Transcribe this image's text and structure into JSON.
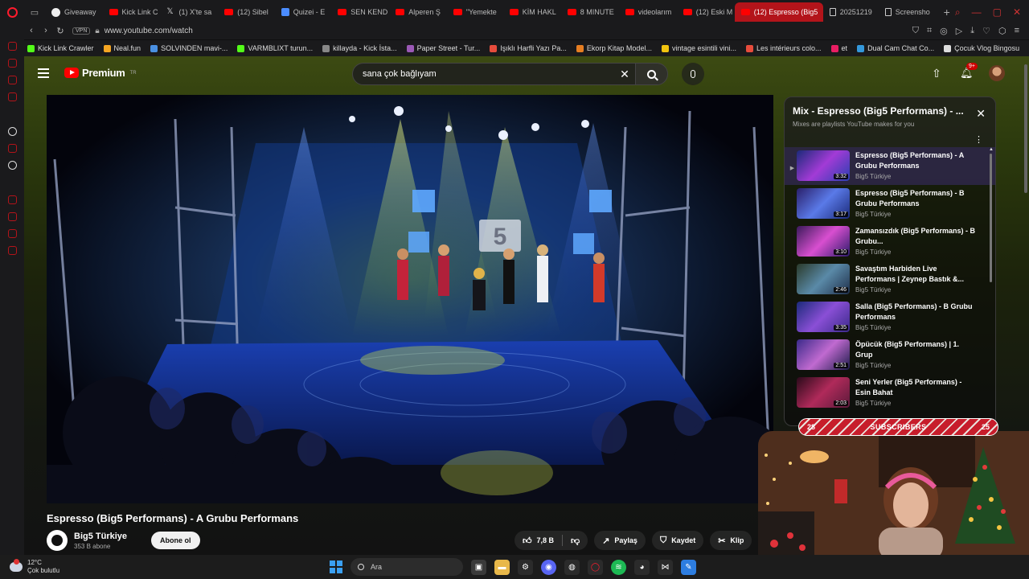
{
  "browser": {
    "tabs": [
      {
        "label": "Giveaway",
        "fav": "gh"
      },
      {
        "label": "Kick Link C",
        "fav": "yt"
      },
      {
        "label": "(1) X'te sa",
        "fav": "x"
      },
      {
        "label": "(12) Sibel",
        "fav": "yt"
      },
      {
        "label": "Quizei - E",
        "fav": "quiz"
      },
      {
        "label": "SEN KEND",
        "fav": "yt"
      },
      {
        "label": "Alperen Ş",
        "fav": "yt"
      },
      {
        "label": "\"Yemekte",
        "fav": "yt"
      },
      {
        "label": "KİM HAKL",
        "fav": "yt"
      },
      {
        "label": "8 MINUTE",
        "fav": "yt"
      },
      {
        "label": "videolarım",
        "fav": "yt"
      },
      {
        "label": "(12) Eski M",
        "fav": "yt"
      },
      {
        "label": "(12) Espresso (Big5",
        "fav": "yt",
        "active": true
      },
      {
        "label": "20251219",
        "fav": "doc"
      },
      {
        "label": "Screensho",
        "fav": "doc"
      }
    ],
    "url": "www.youtube.com/watch",
    "vpn_label": "VPN",
    "bookmarks": [
      "Kick Link Crawler",
      "Neal.fun",
      "SOLVINDEN mavi-...",
      "VARMBLIXT turun...",
      "killayda - Kick İsta...",
      "Paper Street - Tur...",
      "Işıklı Harfli Yazı Pa...",
      "Ekorp Kitap Model...",
      "vintage esintili vini...",
      "Les intérieurs colo...",
      "et",
      "Dual Cam Chat Co...",
      "Çocuk Vlog Bingosu"
    ]
  },
  "youtube": {
    "logo_text": "Premium",
    "logo_region": "TR",
    "search": {
      "value": "sana çok bağlıyam"
    },
    "notif_count": "9+",
    "video": {
      "title": "Espresso (Big5 Performans) - A Grubu Performans",
      "stage_logo": "5"
    },
    "channel": {
      "name": "Big5 Türkiye",
      "subs": "353 B abone",
      "subscribe_label": "Abone ol"
    },
    "actions": {
      "likes": "7,8 B",
      "share": "Paylaş",
      "save": "Kaydet",
      "clip": "Klip"
    },
    "playlist": {
      "title": "Mix - Espresso (Big5 Performans) - ...",
      "subtitle": "Mixes are playlists YouTube makes for you",
      "items": [
        {
          "title": "Espresso (Big5 Performans) - A Grubu Performans",
          "channel": "Big5 Türkiye",
          "duration": "3:32",
          "current": true
        },
        {
          "title": "Espresso (Big5 Performans) - B Grubu Performans",
          "channel": "Big5 Türkiye",
          "duration": "3:17"
        },
        {
          "title": "Zamansızdık (Big5 Performans) - B Grubu...",
          "channel": "Big5 Türkiye",
          "duration": "3:10"
        },
        {
          "title": "Savaştım Harbiden Live Performans | Zeynep Bastık &...",
          "channel": "Big5 Türkiye",
          "duration": "2:46"
        },
        {
          "title": "Salla (Big5 Performans) - B Grubu Performans",
          "channel": "Big5 Türkiye",
          "duration": "3:35"
        },
        {
          "title": "Öpücük (Big5 Performans) | 1. Grup",
          "channel": "Big5 Türkiye",
          "duration": "2:51"
        },
        {
          "title": "Seni Yerler (Big5 Performans) - Esin Bahat",
          "channel": "Big5 Türkiye",
          "duration": "2:03"
        }
      ]
    }
  },
  "stream_overlay": {
    "label": "SUBSCRIBERS",
    "left": "28",
    "right": "25"
  },
  "taskbar": {
    "temp": "12°C",
    "condition": "Çok bulutlu",
    "search_label": "Ara"
  }
}
